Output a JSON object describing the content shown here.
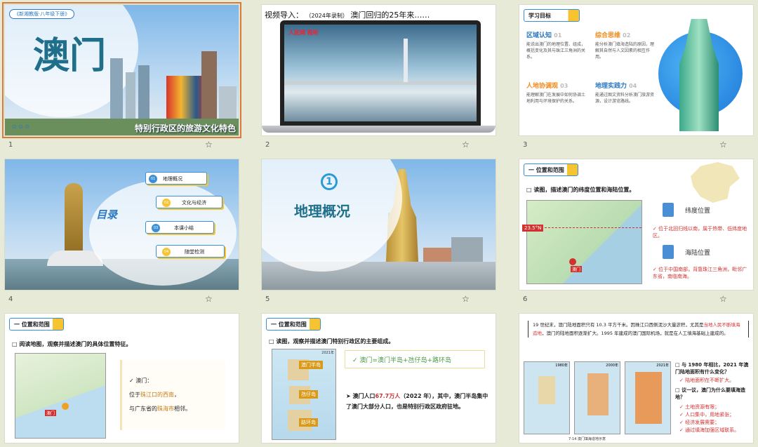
{
  "slides": [
    {
      "number": "1",
      "tag": "《新湘教版·八年级下册》",
      "title": "澳门",
      "subtitle": "特别行政区的旅游文化特色",
      "dots": "⊙ ⊙ ⊙"
    },
    {
      "number": "2",
      "title": "视频导入：",
      "year": "（2024年录制）",
      "caption": "澳门回归的25年来……",
      "logo": "人民网 视听"
    },
    {
      "number": "3",
      "header": "学习目标",
      "goals": [
        {
          "title": "区域认知",
          "no": "01",
          "text": "能说出澳门的地理位置、组成，概括变化及其与珠江三角洲的关系。"
        },
        {
          "title": "综合思维",
          "no": "02",
          "text": "能分析澳门填海造陆的原因，理解其自然与人文因素的相互作用。"
        },
        {
          "title": "人地协调观",
          "no": "03",
          "text": "能理解澳门在发展中如何协调土地利用与环境保护的关系。"
        },
        {
          "title": "地理实践力",
          "no": "04",
          "text": "能通过图文资料分析澳门旅游资源，设计游览路线。"
        }
      ]
    },
    {
      "number": "4",
      "title": "目录",
      "items": [
        {
          "no": "01",
          "label": "地理概况"
        },
        {
          "no": "02",
          "label": "文化与经济"
        },
        {
          "no": "03",
          "label": "本课小结"
        },
        {
          "no": "04",
          "label": "随堂检测"
        }
      ]
    },
    {
      "number": "5",
      "badge": "1",
      "title": "地理概况"
    },
    {
      "number": "6",
      "tag": "一 位置和范围",
      "question": "读图，描述澳门的纬度位置和海陆位置。",
      "lat_label": "23.5°N",
      "city": "澳门",
      "pos1_title": "纬度位置",
      "pos1_text": "位于北回归线以南，属于热带、低纬度地区。",
      "pos2_title": "海陆位置",
      "pos2_text": "位于中国南部，背靠珠江三角洲，毗邻广东省，南临南海。"
    },
    {
      "number": "7",
      "tag": "一 位置和范围",
      "question": "阅读地图，观察并描述澳门的具体位置特征。",
      "answer_head": "澳门：",
      "answer_l1_a": "位于",
      "answer_l1_b": "珠江口的西南",
      "answer_l1_c": "，",
      "answer_l2_a": "与广东省的",
      "answer_l2_b": "珠海市",
      "answer_l2_c": "相邻。",
      "map_label": "澳门"
    },
    {
      "number": "8",
      "tag": "一 位置和范围",
      "question": "读图，观察并描述澳门特别行政区的主要组成。",
      "map_year": "2021年",
      "labels": [
        "澳门半岛",
        "氹仔岛",
        "路环岛"
      ],
      "formula": "澳门=澳门半岛+氹仔岛+路环岛",
      "pop_a": "澳门人口",
      "pop_b": "67.7万人",
      "pop_c": "（2022 年），其中，澳门半岛集中了澳门大部分人口，也是特别行政区政府驻地。"
    },
    {
      "number": "9",
      "intro_a": "19 世纪末，澳门陆地面积只有 10.3 平方千米。因珠江口西侧泥沙大量淤积，尤其是",
      "intro_b": "当地人民不断填海造地",
      "intro_c": "，澳门的陆地面积逐渐扩大。1995 年建成的澳门国际机场，就是在人工填海基础上建成的。",
      "years": [
        "1980年",
        "2000年",
        "2021年"
      ],
      "q1": "与 1980 年相比，2021 年澳门陆地面积有什么变化？",
      "a1": "陆地面积在不断扩大。",
      "q2": "议一议，澳门为什么要填海造地？",
      "a2": [
        "土地资源有限；",
        "人口集中，用地紧张；",
        "经济发展需要；",
        "通过填海加强区域联系。"
      ],
      "fig_caption": "7-14 澳门填海造地示意"
    }
  ]
}
